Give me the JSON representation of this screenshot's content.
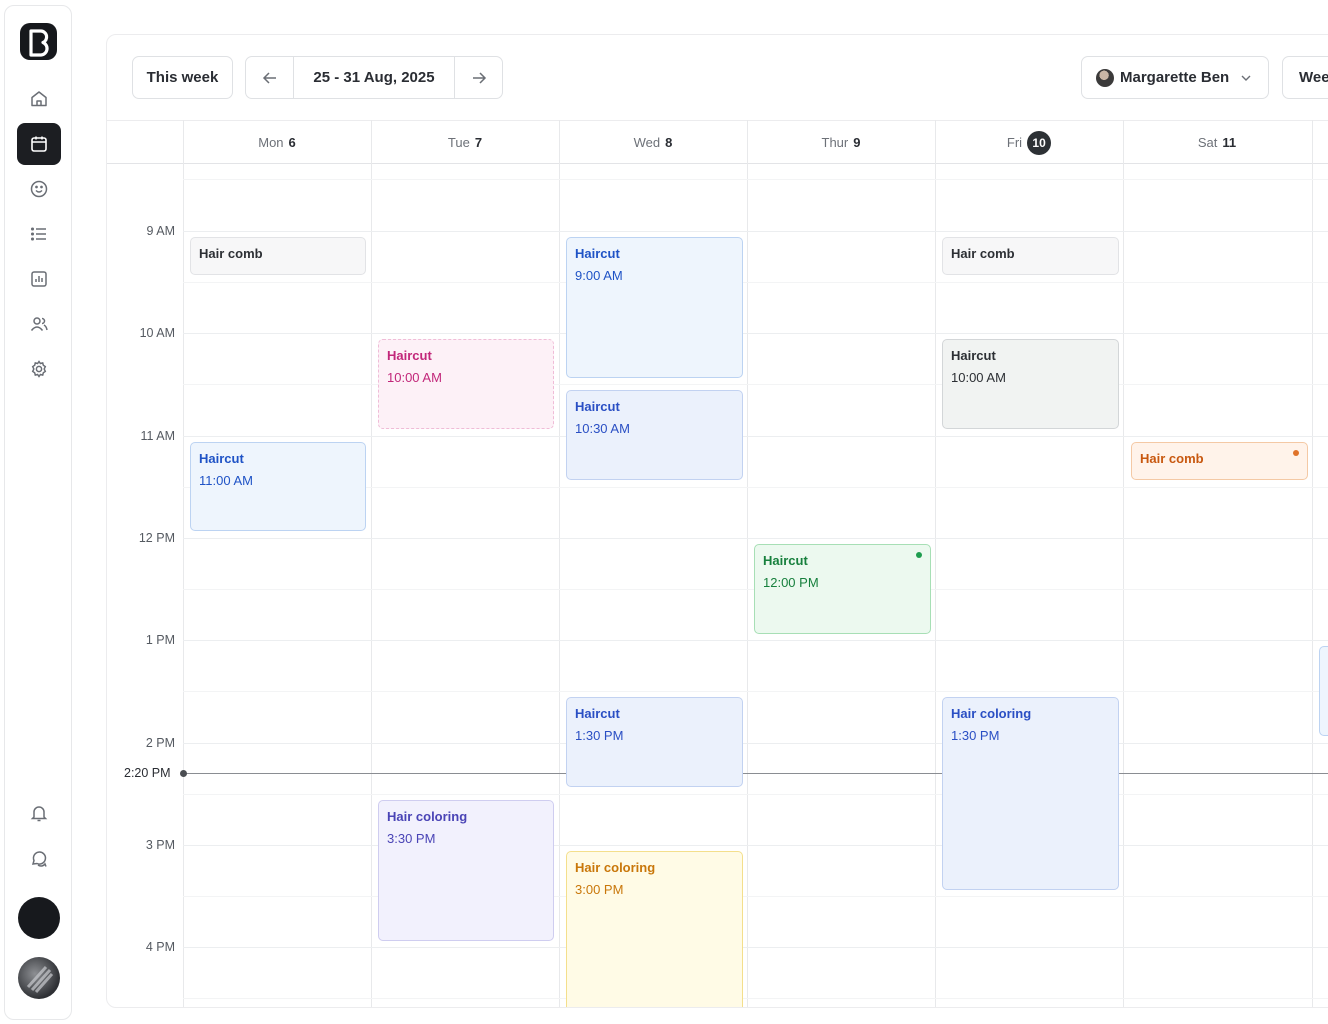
{
  "toolbar": {
    "this_week": "This week",
    "date_range": "25 - 31 Aug, 2025",
    "staff_name": "Margarette Ben",
    "view_label": "Wee"
  },
  "days": [
    {
      "name": "Mon",
      "num": "6"
    },
    {
      "name": "Tue",
      "num": "7"
    },
    {
      "name": "Wed",
      "num": "8"
    },
    {
      "name": "Thur",
      "num": "9"
    },
    {
      "name": "Fri",
      "num": "10",
      "today": true
    },
    {
      "name": "Sat",
      "num": "11"
    }
  ],
  "times": [
    "9 AM",
    "10 AM",
    "11 AM",
    "12 PM",
    "1 PM",
    "2 PM",
    "3 PM",
    "4 PM"
  ],
  "now": {
    "label": "2:20 PM"
  },
  "events": [
    {
      "title": "Hair comb",
      "time": "",
      "color": "gray"
    },
    {
      "title": "Haircut",
      "time": "11:00 AM",
      "color": "blue"
    },
    {
      "title": "Haircut",
      "time": "10:00 AM",
      "color": "pink"
    },
    {
      "title": "Hair coloring",
      "time": "3:30 PM",
      "color": "purple"
    },
    {
      "title": "Haircut",
      "time": "9:00 AM",
      "color": "blue"
    },
    {
      "title": "Haircut",
      "time": "10:30 AM",
      "color": "blue2"
    },
    {
      "title": "Haircut",
      "time": "1:30 PM",
      "color": "blue2"
    },
    {
      "title": "Hair coloring",
      "time": "3:00 PM",
      "color": "yellow"
    },
    {
      "title": "Haircut",
      "time": "12:00 PM",
      "color": "green"
    },
    {
      "title": "Hair comb",
      "time": "",
      "color": "gray"
    },
    {
      "title": "Haircut",
      "time": "10:00 AM",
      "color": "slate"
    },
    {
      "title": "Hair coloring",
      "time": "1:30 PM",
      "color": "blue2"
    },
    {
      "title": "Hair comb",
      "time": "",
      "color": "orange"
    }
  ],
  "colors": {
    "accent_dark": "#1c1e22",
    "now_line": "#8a8d92",
    "green_dot": "#1f9d4f",
    "orange_dot": "#e0732a"
  },
  "icons": [
    "logo-icon",
    "home-icon",
    "calendar-icon",
    "smile-icon",
    "list-icon",
    "chart-icon",
    "users-icon",
    "gear-icon",
    "bell-icon",
    "chat-icon",
    "arrow-left-icon",
    "arrow-right-icon",
    "chevron-down-icon"
  ]
}
